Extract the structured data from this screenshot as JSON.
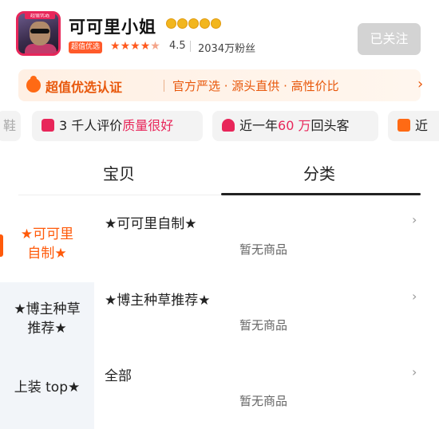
{
  "shop": {
    "name": "可可里小姐",
    "avatar_ribbon": "超值优选",
    "badge": "超值优选",
    "rating": "4.5",
    "fans": "2034万粉丝",
    "follow_label": "已关注",
    "diamond_count": 5,
    "star_fill": 4.5
  },
  "cert": {
    "title": "超值优选认证",
    "desc": "官方严选 · 源头直供 · 高性价比",
    "chevron": "›"
  },
  "pills": {
    "left_fragment": "鞋",
    "quality_prefix": "3 千人评价",
    "quality_hl": "质量很好",
    "repeat_prefix": "近一年",
    "repeat_hl": "60 万",
    "repeat_suffix": "回头客",
    "right_fragment": "近"
  },
  "tabs": [
    {
      "label": "宝贝"
    },
    {
      "label": "分类"
    }
  ],
  "sidebar": {
    "items": [
      {
        "label_line1": "★可可里",
        "label_line2": "自制★"
      },
      {
        "label_line1": "★博主种草",
        "label_line2": "推荐★"
      },
      {
        "label_line1": "上装 top★",
        "label_line2": ""
      }
    ]
  },
  "sections": [
    {
      "title": "★可可里自制★",
      "empty_text": "暂无商品",
      "chevron": "›"
    },
    {
      "title": "★博主种草推荐★",
      "empty_text": "暂无商品",
      "chevron": "›"
    },
    {
      "title": "全部",
      "empty_text": "暂无商品",
      "chevron": "›"
    }
  ],
  "colors": {
    "accent": "#ff5a0a",
    "pink": "#e8265a",
    "sidebar_bg": "#f2f5f9"
  }
}
